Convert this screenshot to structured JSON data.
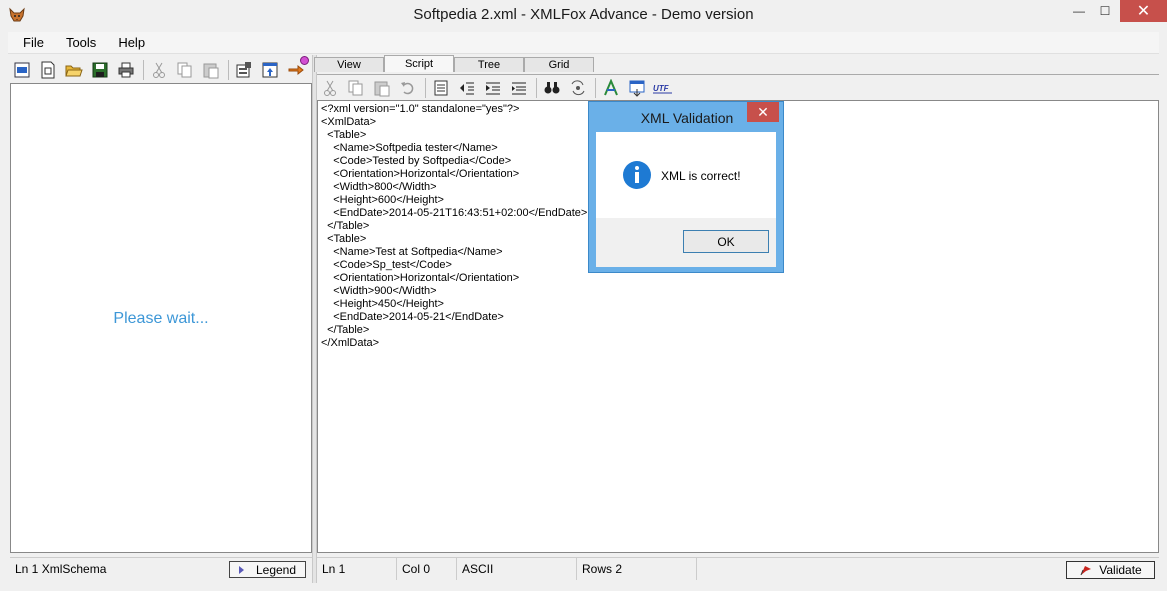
{
  "window": {
    "title": "Softpedia 2.xml - XMLFox Advance - Demo version",
    "minimize_glyph": "—",
    "maximize_glyph": "☐",
    "close_glyph": "✕"
  },
  "menu": {
    "items": [
      {
        "label": "File"
      },
      {
        "label": "Tools"
      },
      {
        "label": "Help"
      }
    ]
  },
  "left_pane": {
    "toolbar_icons": [
      "open-xml-icon",
      "new-schema-icon",
      "open-folder-icon",
      "save-icon",
      "print-icon",
      "cut-icon",
      "copy-icon",
      "paste-icon",
      "properties-icon",
      "export-icon",
      "next-arrow-icon"
    ],
    "loading_text": "Please wait...",
    "status_text": "Ln 1  XmlSchema",
    "legend_label": "Legend"
  },
  "right_pane": {
    "tabs": [
      {
        "label": "View"
      },
      {
        "label": "Script"
      },
      {
        "label": "Tree"
      },
      {
        "label": "Grid"
      }
    ],
    "active_tab": "Script",
    "toolbar_icons": [
      "cut-icon",
      "copy-icon",
      "paste-icon",
      "undo-icon",
      "document-icon",
      "indent-icon",
      "outdent-icon",
      "format-icon",
      "find-icon",
      "replace-icon",
      "text-icon",
      "window-icon",
      "utf-icon"
    ],
    "code_lines": [
      "<?xml version=\"1.0\" standalone=\"yes\"?>",
      "<XmlData>",
      "  <Table>",
      "    <Name>Softpedia tester</Name>",
      "    <Code>Tested by Softpedia</Code>",
      "    <Orientation>Horizontal</Orientation>",
      "    <Width>800</Width>",
      "    <Height>600</Height>",
      "    <EndDate>2014-05-21T16:43:51+02:00</EndDate>",
      "  </Table>",
      "  <Table>",
      "    <Name>Test at Softpedia</Name>",
      "    <Code>Sp_test</Code>",
      "    <Orientation>Horizontal</Orientation>",
      "    <Width>900</Width>",
      "    <Height>450</Height>",
      "    <EndDate>2014-05-21</EndDate>",
      "  </Table>",
      "</XmlData>"
    ],
    "status": {
      "line": "Ln 1",
      "col": "Col 0",
      "encoding": "ASCII",
      "rows": "Rows 2"
    },
    "validate_label": "Validate"
  },
  "dialog": {
    "title": "XML Validation",
    "message": "XML is correct!",
    "ok_label": "OK",
    "close_glyph": "✕"
  }
}
